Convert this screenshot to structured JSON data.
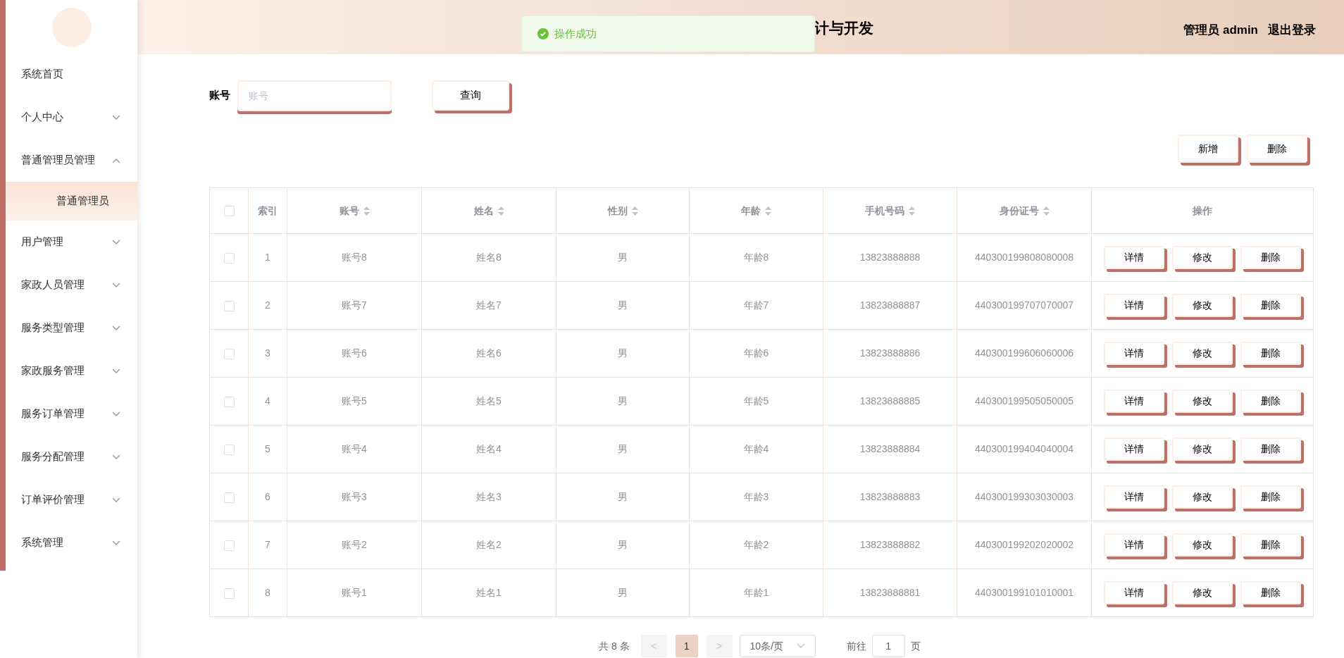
{
  "sidebar": {
    "items": [
      {
        "label": "系统首页",
        "expandable": false
      },
      {
        "label": "个人中心",
        "expandable": true,
        "expanded": false
      },
      {
        "label": "普通管理员管理",
        "expandable": true,
        "expanded": true,
        "children": [
          {
            "label": "普通管理员",
            "selected": true
          }
        ]
      },
      {
        "label": "用户管理",
        "expandable": true,
        "expanded": false
      },
      {
        "label": "家政人员管理",
        "expandable": true,
        "expanded": false
      },
      {
        "label": "服务类型管理",
        "expandable": true,
        "expanded": false
      },
      {
        "label": "家政服务管理",
        "expandable": true,
        "expanded": false
      },
      {
        "label": "服务订单管理",
        "expandable": true,
        "expanded": false
      },
      {
        "label": "服务分配管理",
        "expandable": true,
        "expanded": false
      },
      {
        "label": "订单评价管理",
        "expandable": true,
        "expanded": false
      },
      {
        "label": "系统管理",
        "expandable": true,
        "expanded": false
      }
    ]
  },
  "header": {
    "title": "计与开发",
    "user": "管理员 admin",
    "logout": "退出登录"
  },
  "toast": {
    "message": "操作成功"
  },
  "search": {
    "label": "账号",
    "placeholder": "账号",
    "button": "查询"
  },
  "toolbar": [
    "新增",
    "删除"
  ],
  "table": {
    "columns": [
      {
        "label": "索引",
        "sortable": false
      },
      {
        "label": "账号",
        "sortable": true
      },
      {
        "label": "姓名",
        "sortable": true
      },
      {
        "label": "性别",
        "sortable": true
      },
      {
        "label": "年龄",
        "sortable": true
      },
      {
        "label": "手机号码",
        "sortable": true
      },
      {
        "label": "身份证号",
        "sortable": true
      },
      {
        "label": "操作",
        "sortable": false
      }
    ],
    "header_checked": false,
    "rows": [
      {
        "checked": false,
        "cells": [
          "1",
          "账号8",
          "姓名8",
          "男",
          "年龄8",
          "13823888888",
          "440300199808080008"
        ],
        "actions": [
          "详情",
          "修改",
          "删除"
        ]
      },
      {
        "checked": false,
        "cells": [
          "2",
          "账号7",
          "姓名7",
          "男",
          "年龄7",
          "13823888887",
          "440300199707070007"
        ],
        "actions": [
          "详情",
          "修改",
          "删除"
        ]
      },
      {
        "checked": false,
        "cells": [
          "3",
          "账号6",
          "姓名6",
          "男",
          "年龄6",
          "13823888886",
          "440300199606060006"
        ],
        "actions": [
          "详情",
          "修改",
          "删除"
        ]
      },
      {
        "checked": false,
        "cells": [
          "4",
          "账号5",
          "姓名5",
          "男",
          "年龄5",
          "13823888885",
          "440300199505050005"
        ],
        "actions": [
          "详情",
          "修改",
          "删除"
        ]
      },
      {
        "checked": false,
        "cells": [
          "5",
          "账号4",
          "姓名4",
          "男",
          "年龄4",
          "13823888884",
          "440300199404040004"
        ],
        "actions": [
          "详情",
          "修改",
          "删除"
        ]
      },
      {
        "checked": false,
        "cells": [
          "6",
          "账号3",
          "姓名3",
          "男",
          "年龄3",
          "13823888883",
          "440300199303030003"
        ],
        "actions": [
          "详情",
          "修改",
          "删除"
        ]
      },
      {
        "checked": false,
        "cells": [
          "7",
          "账号2",
          "姓名2",
          "男",
          "年龄2",
          "13823888882",
          "440300199202020002"
        ],
        "actions": [
          "详情",
          "修改",
          "删除"
        ]
      },
      {
        "checked": false,
        "cells": [
          "8",
          "账号1",
          "姓名1",
          "男",
          "年龄1",
          "13823888881",
          "440300199101010001"
        ],
        "actions": [
          "详情",
          "修改",
          "删除"
        ]
      }
    ]
  },
  "pagination": {
    "total": "共 8 条",
    "prev": "<",
    "pages": [
      {
        "label": "1",
        "selected": true
      }
    ],
    "next": ">",
    "page_size": "10条/页",
    "goto_label": "前往",
    "goto_value": "1",
    "goto_suffix": "页"
  }
}
